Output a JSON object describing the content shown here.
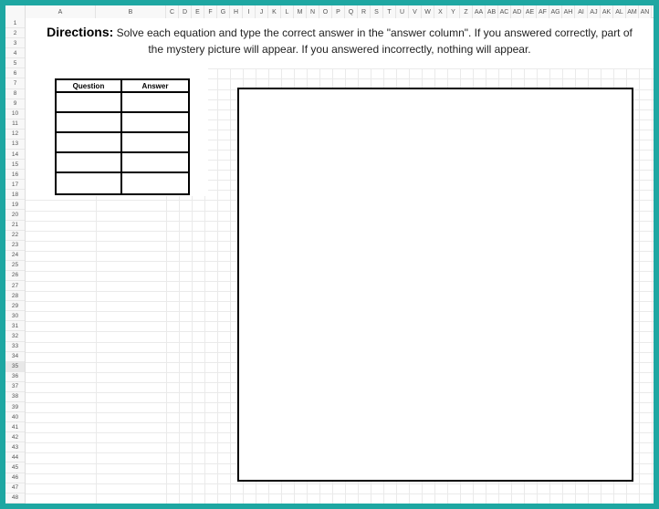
{
  "columns": [
    {
      "label": "A",
      "width": 77
    },
    {
      "label": "B",
      "width": 77
    },
    {
      "label": "C",
      "width": 14
    },
    {
      "label": "D",
      "width": 14
    },
    {
      "label": "E",
      "width": 14
    },
    {
      "label": "F",
      "width": 14
    },
    {
      "label": "G",
      "width": 14
    },
    {
      "label": "H",
      "width": 14
    },
    {
      "label": "I",
      "width": 14
    },
    {
      "label": "J",
      "width": 14
    },
    {
      "label": "K",
      "width": 14
    },
    {
      "label": "L",
      "width": 14
    },
    {
      "label": "M",
      "width": 14
    },
    {
      "label": "N",
      "width": 14
    },
    {
      "label": "O",
      "width": 14
    },
    {
      "label": "P",
      "width": 14
    },
    {
      "label": "Q",
      "width": 14
    },
    {
      "label": "R",
      "width": 14
    },
    {
      "label": "S",
      "width": 14
    },
    {
      "label": "T",
      "width": 14
    },
    {
      "label": "U",
      "width": 14
    },
    {
      "label": "V",
      "width": 14
    },
    {
      "label": "W",
      "width": 14
    },
    {
      "label": "X",
      "width": 14
    },
    {
      "label": "Y",
      "width": 14
    },
    {
      "label": "Z",
      "width": 14
    },
    {
      "label": "AA",
      "width": 14
    },
    {
      "label": "AB",
      "width": 14
    },
    {
      "label": "AC",
      "width": 14
    },
    {
      "label": "AD",
      "width": 14
    },
    {
      "label": "AE",
      "width": 14
    },
    {
      "label": "AF",
      "width": 14
    },
    {
      "label": "AG",
      "width": 14
    },
    {
      "label": "AH",
      "width": 14
    },
    {
      "label": "AI",
      "width": 14
    },
    {
      "label": "AJ",
      "width": 14
    },
    {
      "label": "AK",
      "width": 14
    },
    {
      "label": "AL",
      "width": 14
    },
    {
      "label": "AM",
      "width": 14
    },
    {
      "label": "AN",
      "width": 14
    }
  ],
  "row_count": 48,
  "selected_row": 35,
  "directions": {
    "label": "Directions:",
    "text": " Solve each equation and type the correct answer in the \"answer column\". If you answered correctly, part of the mystery picture will appear. If you answered incorrectly, nothing will appear."
  },
  "qa_table": {
    "headers": [
      "Question",
      "Answer"
    ],
    "rows": [
      {
        "question": "",
        "answer": ""
      },
      {
        "question": "",
        "answer": ""
      },
      {
        "question": "",
        "answer": ""
      },
      {
        "question": "",
        "answer": ""
      },
      {
        "question": "",
        "answer": ""
      }
    ]
  }
}
